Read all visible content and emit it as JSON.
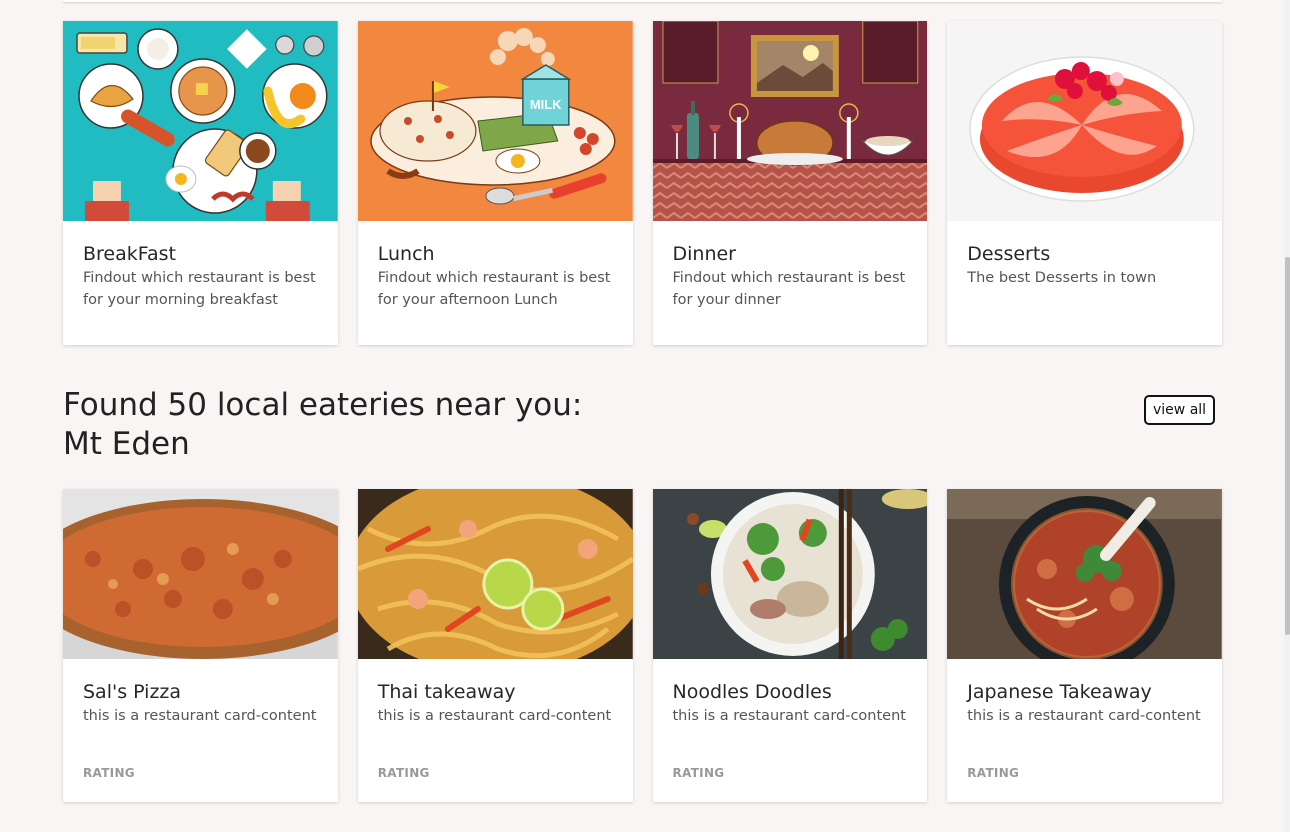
{
  "meal_cards": [
    {
      "title": "BreakFast",
      "description": "Findout which restaurant is best for your morning breakfast",
      "image_icon": "breakfast-illustration"
    },
    {
      "title": "Lunch",
      "description": "Findout which restaurant is best for your afternoon Lunch",
      "image_icon": "lunch-illustration",
      "milk_label": "MILK"
    },
    {
      "title": "Dinner",
      "description": "Findout which restaurant is best for your dinner",
      "image_icon": "dinner-illustration"
    },
    {
      "title": "Desserts",
      "description": "The best Desserts in town",
      "image_icon": "dessert-illustration"
    }
  ],
  "eateries": {
    "heading": "Found 50 local eateries near you: Mt Eden",
    "view_all_label": "view all",
    "cards": [
      {
        "title": "Sal's Pizza",
        "description": "this is a restaurant card-content",
        "rating_label": "RATING",
        "image_icon": "pizza-photo"
      },
      {
        "title": "Thai takeaway",
        "description": "this is a restaurant card-content",
        "rating_label": "RATING",
        "image_icon": "thai-noodles-photo"
      },
      {
        "title": "Noodles Doodles",
        "description": "this is a restaurant card-content",
        "rating_label": "RATING",
        "image_icon": "noodle-bowl-photo"
      },
      {
        "title": "Japanese Takeaway",
        "description": "this is a restaurant card-content",
        "rating_label": "RATING",
        "image_icon": "ramen-photo"
      }
    ]
  },
  "colors": {
    "page_background": "#f9f5f4",
    "breakfast_bg": "#20bcc2",
    "lunch_bg": "#f2883f",
    "dinner_bg": "#7a2a3e",
    "dessert_bg": "#f5f5f5"
  }
}
